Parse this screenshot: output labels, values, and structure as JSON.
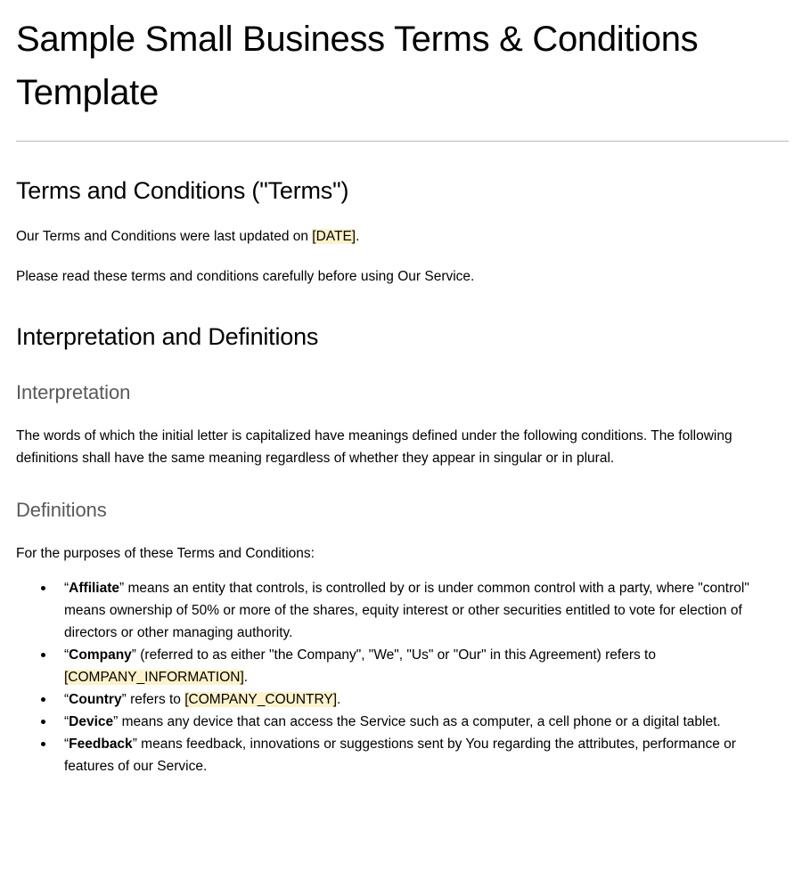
{
  "document": {
    "title": "Sample Small Business Terms & Conditions Template",
    "sections": {
      "terms_heading": "Terms and Conditions (\"Terms\")",
      "last_updated_prefix": "Our Terms and Conditions were last updated on ",
      "last_updated_placeholder": "[DATE]",
      "last_updated_suffix": ".",
      "please_read": "Please read these terms and conditions carefully before using Our Service.",
      "interpretation_and_definitions_heading": "Interpretation and Definitions",
      "interpretation_subheading": "Interpretation",
      "interpretation_body": "The words of which the initial letter is capitalized have meanings defined under the following conditions. The following definitions shall have the same meaning regardless of whether they appear in singular or in plural.",
      "definitions_subheading": "Definitions",
      "definitions_intro": "For the purposes of these Terms and Conditions:"
    },
    "definitions": [
      {
        "open_quote": "“",
        "term": "Affiliate",
        "close_quote": "”",
        "text_before": " means an entity that controls, is controlled by or is under common control with a party, where \"control\" means ownership of 50% or more of the shares, equity interest or other securities entitled to vote for election of directors or other managing authority.",
        "placeholder": "",
        "text_after": ""
      },
      {
        "open_quote": "“",
        "term": "Company",
        "close_quote": "”",
        "text_before": " (referred to as either \"the Company\", \"We\", \"Us\" or \"Our\" in this Agreement) refers to ",
        "placeholder": "[COMPANY_INFORMATION]",
        "text_after": "."
      },
      {
        "open_quote": "“",
        "term": "Country",
        "close_quote": "”",
        "text_before": " refers to ",
        "placeholder": "[COMPANY_COUNTRY]",
        "text_after": "."
      },
      {
        "open_quote": "“",
        "term": "Device",
        "close_quote": "”",
        "text_before": " means any device that can access the Service such as a computer, a cell phone or a digital tablet.",
        "placeholder": "",
        "text_after": ""
      },
      {
        "open_quote": "“",
        "term": "Feedback",
        "close_quote": "”",
        "text_before": " means feedback, innovations or suggestions sent by You regarding the attributes, performance or features of our Service.",
        "placeholder": "",
        "text_after": ""
      }
    ],
    "colors": {
      "highlight": "#fdf2cc",
      "subheading": "#595959",
      "divider": "#b8b8b8",
      "text": "#000000"
    }
  }
}
